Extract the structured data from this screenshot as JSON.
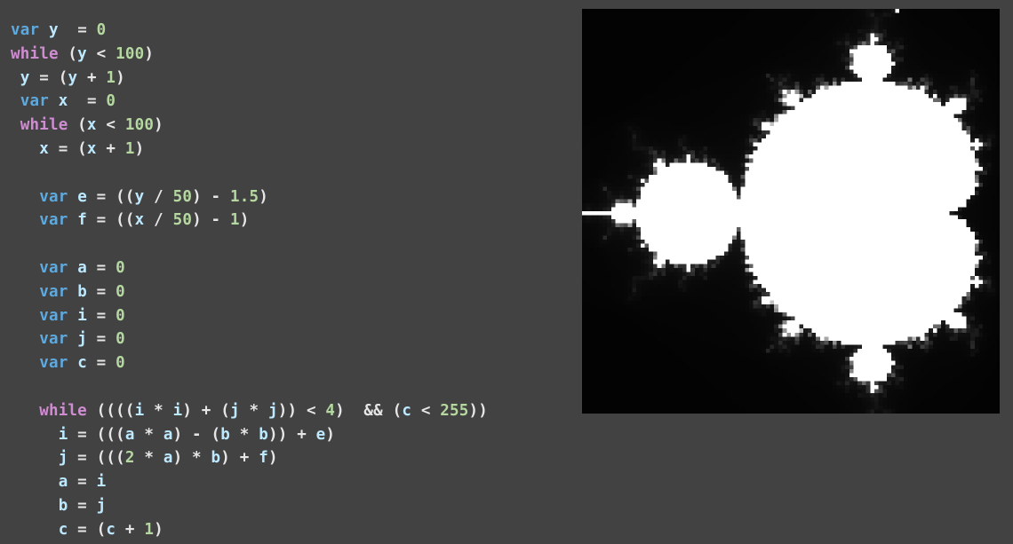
{
  "colors": {
    "background": "#424242",
    "keyword_var": "#5ea9de",
    "keyword_while": "#cf8dd1",
    "identifier": "#bde9ff",
    "number": "#b5d8a0",
    "operator": "#e6e6e6",
    "fractal_fill": "#ffffff",
    "fractal_background": "#000000"
  },
  "code_lines": [
    [
      {
        "t": "var",
        "c": "keyword_var"
      },
      {
        "t": " "
      },
      {
        "t": "y",
        "c": "identifier"
      },
      {
        "t": "  = "
      },
      {
        "t": "0",
        "c": "number"
      }
    ],
    [
      {
        "t": "while",
        "c": "keyword_while"
      },
      {
        "t": " ("
      },
      {
        "t": "y",
        "c": "identifier"
      },
      {
        "t": " < "
      },
      {
        "t": "100",
        "c": "number"
      },
      {
        "t": ")"
      }
    ],
    [
      {
        "t": " "
      },
      {
        "t": "y",
        "c": "identifier"
      },
      {
        "t": " = ("
      },
      {
        "t": "y",
        "c": "identifier"
      },
      {
        "t": " + "
      },
      {
        "t": "1",
        "c": "number"
      },
      {
        "t": ")"
      }
    ],
    [
      {
        "t": " "
      },
      {
        "t": "var",
        "c": "keyword_var"
      },
      {
        "t": " "
      },
      {
        "t": "x",
        "c": "identifier"
      },
      {
        "t": "  = "
      },
      {
        "t": "0",
        "c": "number"
      }
    ],
    [
      {
        "t": " "
      },
      {
        "t": "while",
        "c": "keyword_while"
      },
      {
        "t": " ("
      },
      {
        "t": "x",
        "c": "identifier"
      },
      {
        "t": " < "
      },
      {
        "t": "100",
        "c": "number"
      },
      {
        "t": ")"
      }
    ],
    [
      {
        "t": "   "
      },
      {
        "t": "x",
        "c": "identifier"
      },
      {
        "t": " = ("
      },
      {
        "t": "x",
        "c": "identifier"
      },
      {
        "t": " + "
      },
      {
        "t": "1",
        "c": "number"
      },
      {
        "t": ")"
      }
    ],
    [],
    [
      {
        "t": "   "
      },
      {
        "t": "var",
        "c": "keyword_var"
      },
      {
        "t": " "
      },
      {
        "t": "e",
        "c": "identifier"
      },
      {
        "t": " = (("
      },
      {
        "t": "y",
        "c": "identifier"
      },
      {
        "t": " / "
      },
      {
        "t": "50",
        "c": "number"
      },
      {
        "t": ") - "
      },
      {
        "t": "1.5",
        "c": "number"
      },
      {
        "t": ")"
      }
    ],
    [
      {
        "t": "   "
      },
      {
        "t": "var",
        "c": "keyword_var"
      },
      {
        "t": " "
      },
      {
        "t": "f",
        "c": "identifier"
      },
      {
        "t": " = (("
      },
      {
        "t": "x",
        "c": "identifier"
      },
      {
        "t": " / "
      },
      {
        "t": "50",
        "c": "number"
      },
      {
        "t": ") - "
      },
      {
        "t": "1",
        "c": "number"
      },
      {
        "t": ")"
      }
    ],
    [],
    [
      {
        "t": "   "
      },
      {
        "t": "var",
        "c": "keyword_var"
      },
      {
        "t": " "
      },
      {
        "t": "a",
        "c": "identifier"
      },
      {
        "t": " = "
      },
      {
        "t": "0",
        "c": "number"
      }
    ],
    [
      {
        "t": "   "
      },
      {
        "t": "var",
        "c": "keyword_var"
      },
      {
        "t": " "
      },
      {
        "t": "b",
        "c": "identifier"
      },
      {
        "t": " = "
      },
      {
        "t": "0",
        "c": "number"
      }
    ],
    [
      {
        "t": "   "
      },
      {
        "t": "var",
        "c": "keyword_var"
      },
      {
        "t": " "
      },
      {
        "t": "i",
        "c": "identifier"
      },
      {
        "t": " = "
      },
      {
        "t": "0",
        "c": "number"
      }
    ],
    [
      {
        "t": "   "
      },
      {
        "t": "var",
        "c": "keyword_var"
      },
      {
        "t": " "
      },
      {
        "t": "j",
        "c": "identifier"
      },
      {
        "t": " = "
      },
      {
        "t": "0",
        "c": "number"
      }
    ],
    [
      {
        "t": "   "
      },
      {
        "t": "var",
        "c": "keyword_var"
      },
      {
        "t": " "
      },
      {
        "t": "c",
        "c": "identifier"
      },
      {
        "t": " = "
      },
      {
        "t": "0",
        "c": "number"
      }
    ],
    [],
    [
      {
        "t": "   "
      },
      {
        "t": "while",
        "c": "keyword_while"
      },
      {
        "t": " ((("
      },
      {
        "t": "("
      },
      {
        "t": "i",
        "c": "identifier"
      },
      {
        "t": " * "
      },
      {
        "t": "i",
        "c": "identifier"
      },
      {
        "t": ") + ("
      },
      {
        "t": "j",
        "c": "identifier"
      },
      {
        "t": " * "
      },
      {
        "t": "j",
        "c": "identifier"
      },
      {
        "t": ")) < "
      },
      {
        "t": "4",
        "c": "number"
      },
      {
        "t": ")  && ("
      },
      {
        "t": "c",
        "c": "identifier"
      },
      {
        "t": " < "
      },
      {
        "t": "255",
        "c": "number"
      },
      {
        "t": "))"
      }
    ],
    [
      {
        "t": "     "
      },
      {
        "t": "i",
        "c": "identifier"
      },
      {
        "t": " = ((("
      },
      {
        "t": "a",
        "c": "identifier"
      },
      {
        "t": " * "
      },
      {
        "t": "a",
        "c": "identifier"
      },
      {
        "t": ") - ("
      },
      {
        "t": "b",
        "c": "identifier"
      },
      {
        "t": " * "
      },
      {
        "t": "b",
        "c": "identifier"
      },
      {
        "t": ")) + "
      },
      {
        "t": "e",
        "c": "identifier"
      },
      {
        "t": ")"
      }
    ],
    [
      {
        "t": "     "
      },
      {
        "t": "j",
        "c": "identifier"
      },
      {
        "t": " = ((("
      },
      {
        "t": "2",
        "c": "number"
      },
      {
        "t": " * "
      },
      {
        "t": "a",
        "c": "identifier"
      },
      {
        "t": ") * "
      },
      {
        "t": "b",
        "c": "identifier"
      },
      {
        "t": ") + "
      },
      {
        "t": "f",
        "c": "identifier"
      },
      {
        "t": ")"
      }
    ],
    [
      {
        "t": "     "
      },
      {
        "t": "a",
        "c": "identifier"
      },
      {
        "t": " = "
      },
      {
        "t": "i",
        "c": "identifier"
      }
    ],
    [
      {
        "t": "     "
      },
      {
        "t": "b",
        "c": "identifier"
      },
      {
        "t": " = "
      },
      {
        "t": "j",
        "c": "identifier"
      }
    ],
    [
      {
        "t": "     "
      },
      {
        "t": "c",
        "c": "identifier"
      },
      {
        "t": " = ("
      },
      {
        "t": "c",
        "c": "identifier"
      },
      {
        "t": " + "
      },
      {
        "t": "1",
        "c": "number"
      },
      {
        "t": ")"
      }
    ]
  ],
  "fractal": {
    "type": "mandelbrot",
    "grid": [
      100,
      100
    ],
    "max_iterations": 255,
    "real_range": [
      -1.5,
      0.5
    ],
    "imag_range": [
      -1,
      1
    ]
  }
}
